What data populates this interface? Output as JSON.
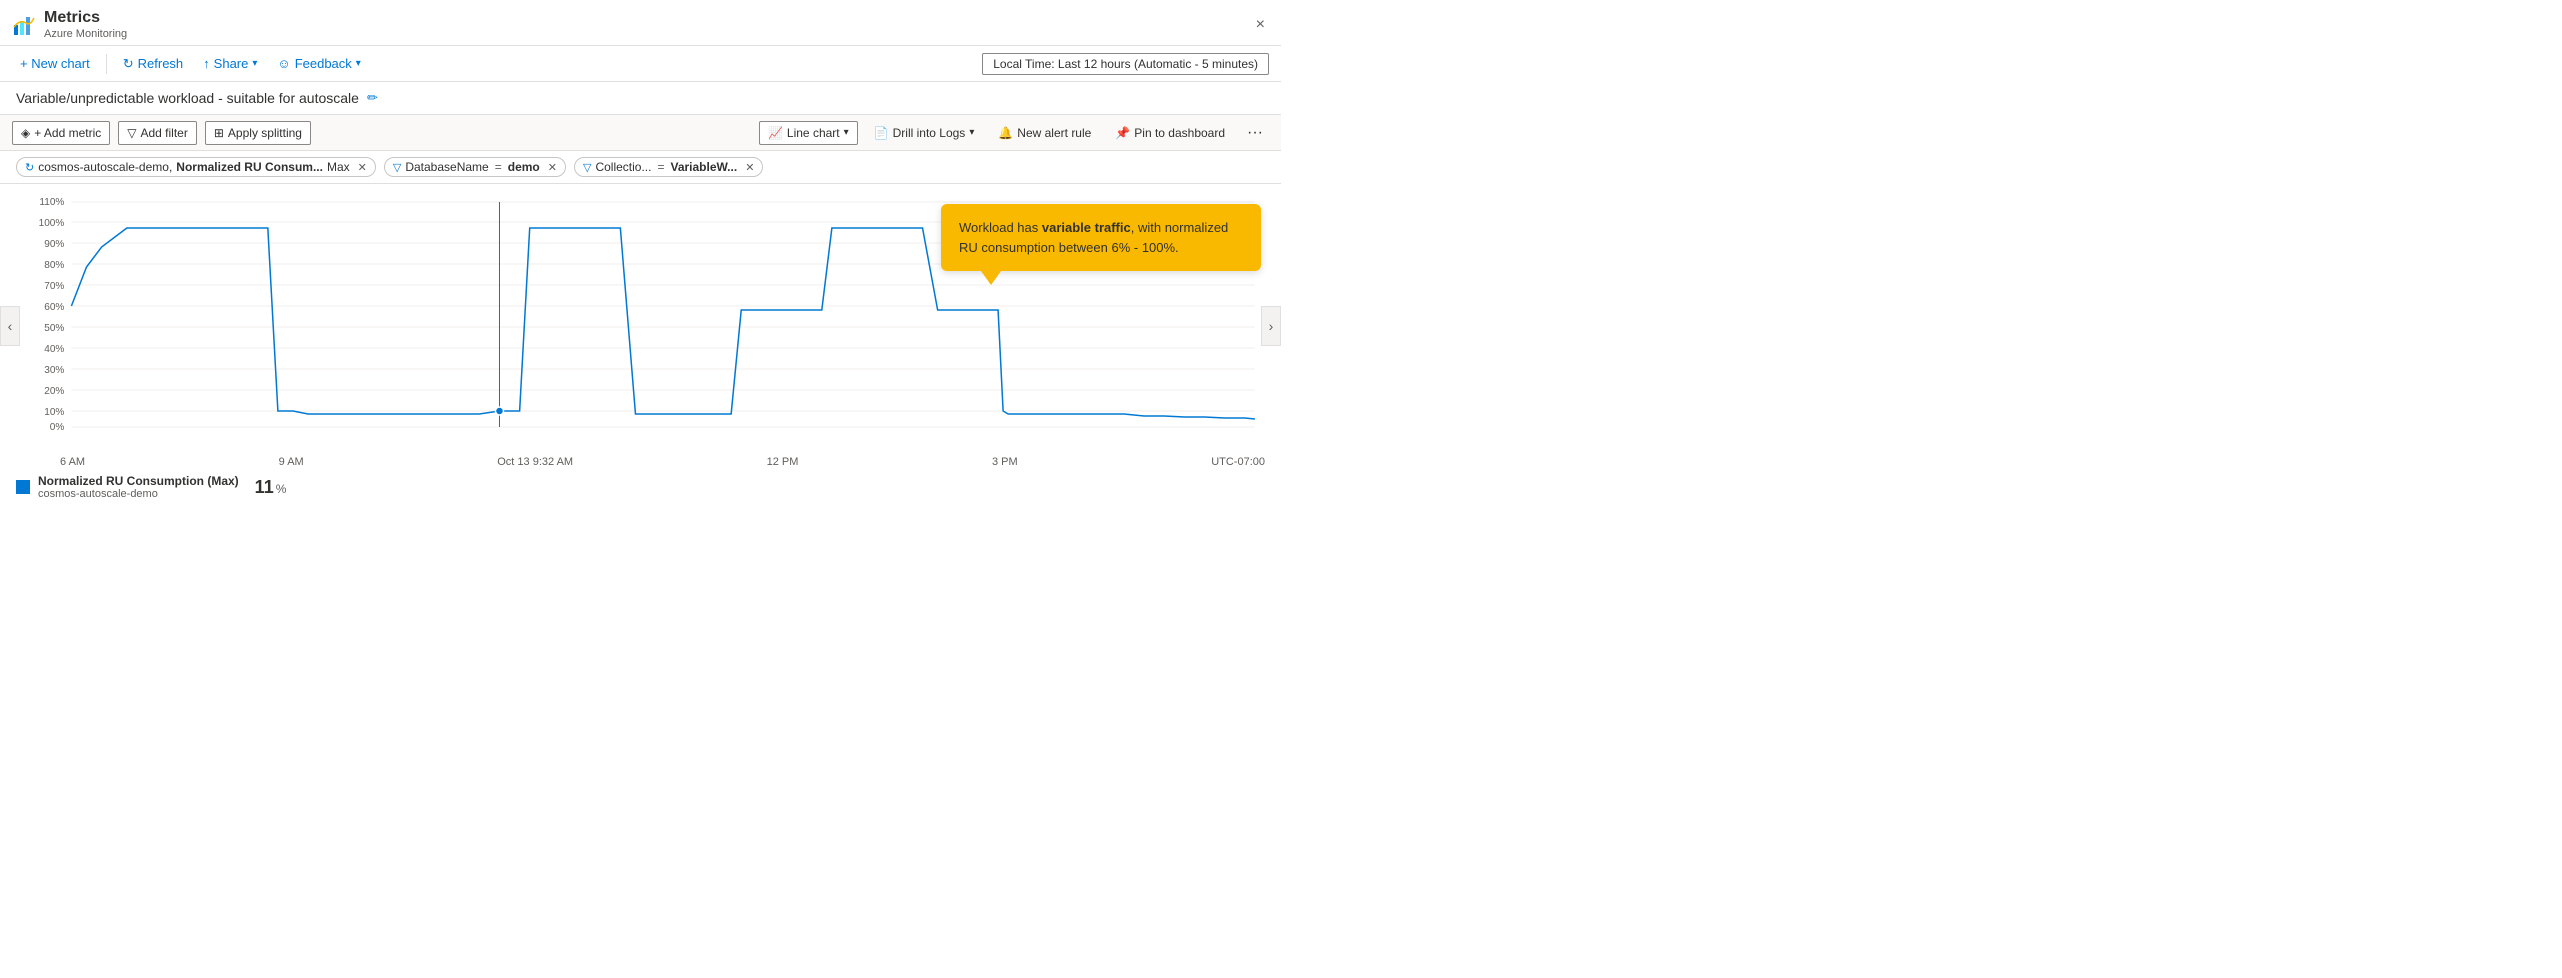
{
  "app": {
    "icon_color": "#0078d4",
    "title": "Metrics",
    "subtitle": "Azure Monitoring",
    "close_label": "×"
  },
  "toolbar": {
    "new_chart_label": "+ New chart",
    "refresh_label": "Refresh",
    "share_label": "Share",
    "feedback_label": "Feedback",
    "time_range_label": "Local Time: Last 12 hours (Automatic - 5 minutes)"
  },
  "chart_title": {
    "text": "Variable/unpredictable workload - suitable for autoscale",
    "edit_icon": "✏"
  },
  "metrics_toolbar": {
    "add_metric_label": "+ Add metric",
    "add_filter_label": "Add filter",
    "apply_splitting_label": "Apply splitting",
    "line_chart_label": "Line chart",
    "drill_logs_label": "Drill into Logs",
    "new_alert_label": "New alert rule",
    "pin_dashboard_label": "Pin to dashboard",
    "more_label": "···"
  },
  "filters": [
    {
      "type": "metric",
      "icon": "↻",
      "text_prefix": "cosmos-autoscale-demo, ",
      "text_bold": "Normalized RU Consum...",
      "text_suffix": " Max"
    },
    {
      "type": "filter",
      "icon": "▽",
      "label": "DatabaseName",
      "equals": "=",
      "value_bold": "demo"
    },
    {
      "type": "filter",
      "icon": "▽",
      "label": "Collectio...",
      "equals": "=",
      "value_bold": "VariableW..."
    }
  ],
  "chart": {
    "y_labels": [
      "110%",
      "100%",
      "90%",
      "80%",
      "70%",
      "60%",
      "50%",
      "40%",
      "30%",
      "20%",
      "10%",
      "0%"
    ],
    "x_labels": [
      "6 AM",
      "9 AM",
      "Oct 13 9:32 AM",
      "12 PM",
      "3 PM",
      "UTC-07:00"
    ],
    "tooltip": {
      "text_normal": "Workload has ",
      "text_bold": "variable traffic",
      "text_rest": ", with normalized RU consumption between 6% - 100%."
    }
  },
  "legend": {
    "label": "Normalized RU Consumption (Max)",
    "sublabel": "cosmos-autoscale-demo",
    "value": "11",
    "unit": "%"
  },
  "nav": {
    "left_arrow": "‹",
    "right_arrow": "›"
  }
}
